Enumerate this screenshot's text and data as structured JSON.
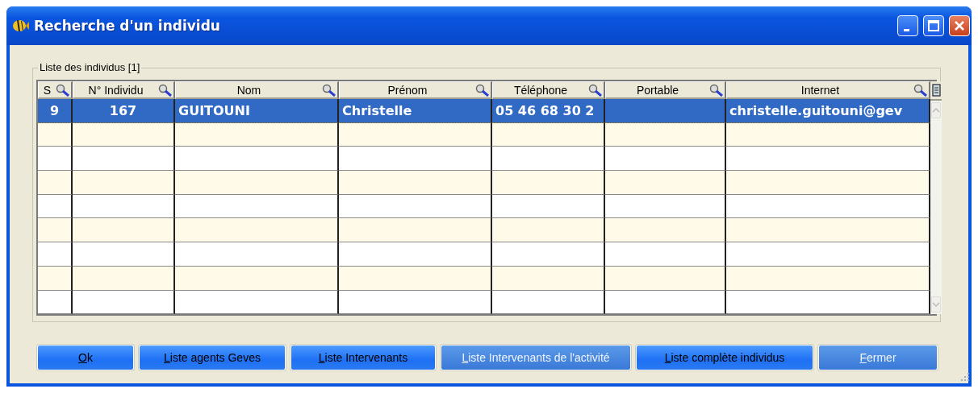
{
  "window": {
    "title": "Recherche d'un individu"
  },
  "group": {
    "title": "Liste des individus [1]"
  },
  "table": {
    "columns": [
      {
        "label": "S"
      },
      {
        "label": "N° Individu"
      },
      {
        "label": "Nom"
      },
      {
        "label": "Prénom"
      },
      {
        "label": "Téléphone"
      },
      {
        "label": "Portable"
      },
      {
        "label": "Internet"
      }
    ],
    "rows": [
      {
        "selected": true,
        "cells": [
          "9",
          "167",
          "GUITOUNI",
          "Christelle",
          "05 46 68 30 2",
          null,
          "christelle.guitouni@gev"
        ]
      }
    ]
  },
  "buttons": [
    {
      "label": "Ok",
      "disabled": false
    },
    {
      "label": "Liste agents Geves",
      "disabled": false
    },
    {
      "label": "Liste Intervenants",
      "disabled": false
    },
    {
      "label": "Liste Intervenants de l'activité",
      "disabled": true
    },
    {
      "label": "Liste complète individus",
      "disabled": false
    },
    {
      "label": "Fermer",
      "disabled": true
    }
  ]
}
